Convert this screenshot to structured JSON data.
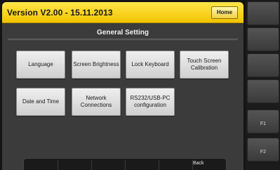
{
  "header": {
    "title": "Version V2.00 - 15.11.2013",
    "home_label": "Home"
  },
  "main": {
    "section_title": "General Setting",
    "tiles": [
      {
        "label": "Language"
      },
      {
        "label": "Screen Brightness"
      },
      {
        "label": "Lock Keyboard"
      },
      {
        "label": "Touch Screen Calibration"
      },
      {
        "label": "Date and Time"
      },
      {
        "label": "Network Connections"
      },
      {
        "label": "RS232/USB-PC configuration"
      }
    ]
  },
  "footer": {
    "back_label": "Back"
  },
  "side_keys": {
    "f1": "F1",
    "f2": "F2"
  },
  "colors": {
    "title_bar": "#f2c400",
    "screen_bg": "#3b3b3b",
    "tile_bg": "#dcdcdc"
  }
}
